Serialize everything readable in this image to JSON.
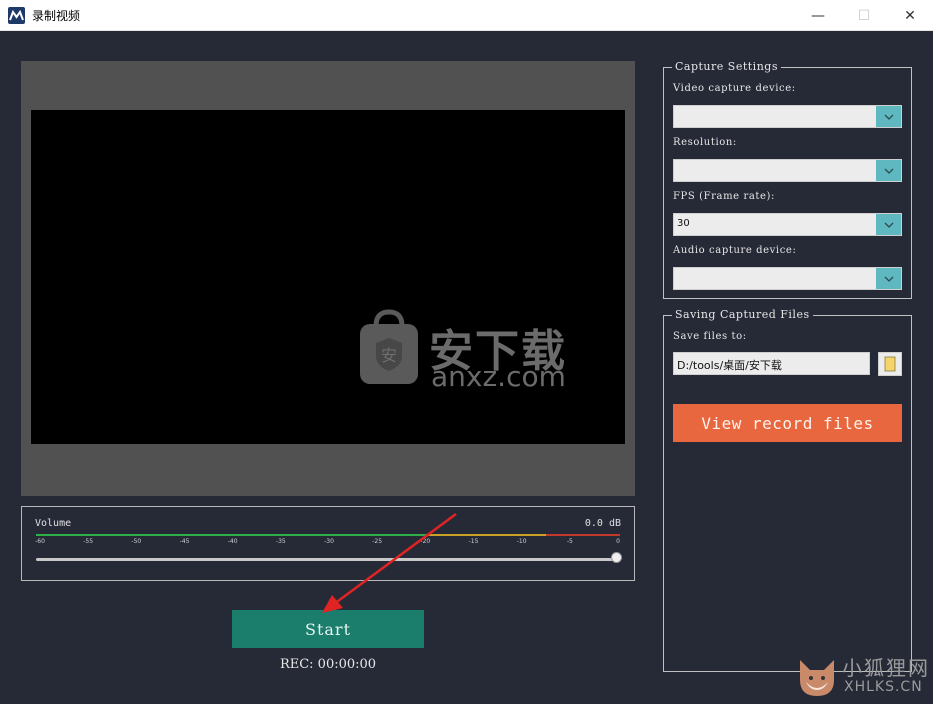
{
  "window": {
    "title": "录制视频",
    "min_glyph": "—",
    "max_glyph": "☐",
    "close_glyph": "✕"
  },
  "preview": {
    "watermark_cn": "安下载",
    "watermark_en": "anxz.com",
    "watermark_badge": "安"
  },
  "volume": {
    "label": "Volume",
    "db_value": "0.0 dB",
    "ticks": [
      "-60",
      "-55",
      "-50",
      "-45",
      "-40",
      "-35",
      "-30",
      "-25",
      "-20",
      "-15",
      "-10",
      "-5",
      "0"
    ],
    "level_fraction": 1.0
  },
  "start_button": {
    "label": "Start"
  },
  "rec_time": "REC: 00:00:00",
  "capture_settings": {
    "title": "Capture Settings",
    "video_device_label": "Video capture device:",
    "video_device_value": "",
    "resolution_label": "Resolution:",
    "resolution_value": "",
    "fps_label": "FPS (Frame rate):",
    "fps_value": "30",
    "audio_device_label": "Audio capture device:",
    "audio_device_value": ""
  },
  "saving": {
    "title": "Saving Captured Files",
    "save_to_label": "Save files to:",
    "path_value": "D:/tools/桌面/安下载",
    "view_button_label": "View record files"
  },
  "corner_watermark": {
    "cn": "小狐狸网",
    "en": "XHLKS.CN"
  },
  "colors": {
    "background": "#262a37",
    "start_button": "#1b7d6c",
    "view_button": "#e8673f",
    "combo_arrow": "#5fb8c0",
    "annotation_arrow": "#e02424"
  }
}
